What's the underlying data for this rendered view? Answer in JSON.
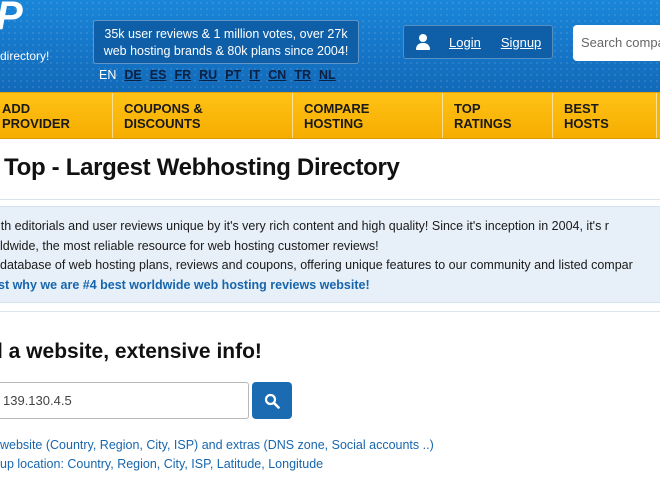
{
  "header": {
    "logo_glyph": "P",
    "tagline": "directory!",
    "stats_line1": "35k user reviews & 1 million votes, over 27k",
    "stats_line2": "web hosting brands & 80k plans since 2004!",
    "languages": [
      "EN",
      "DE",
      "ES",
      "FR",
      "RU",
      "PT",
      "IT",
      "CN",
      "TR",
      "NL"
    ],
    "current_language": "EN",
    "login_label": "Login",
    "signup_label": "Signup",
    "search_placeholder": "Search compa"
  },
  "nav": {
    "items": [
      "ADD PROVIDER",
      "COUPONS & DISCOUNTS",
      "COMPARE HOSTING",
      "TOP RATINGS",
      "BEST HOSTS"
    ]
  },
  "main": {
    "title": "Top - Largest Webhosting Directory",
    "info_lines": [
      "ith editorials and user reviews unique by it's very rich content and high quality! Since it's inception in 2004, it's r",
      "ldwide, the most reliable resource for web hosting customer reviews!",
      " database of web hosting plans, reviews and coupons, offering unique features to our community and listed compar"
    ],
    "info_link": "st why we are #4 best worldwide web hosting reviews website!"
  },
  "lookup": {
    "heading": "l a website, extensive info!",
    "ip_value": "139.130.4.5",
    "link1": "website (Country, Region, City, ISP) and extras (DNS zone, Social accounts ..)",
    "link2": "up location: Country, Region, City, ISP, Latitude, Longitude"
  },
  "colors": {
    "header_blue": "#1574c6",
    "nav_yellow": "#f7b400",
    "link_blue": "#1766ad",
    "button_blue": "#1b6bb3"
  }
}
